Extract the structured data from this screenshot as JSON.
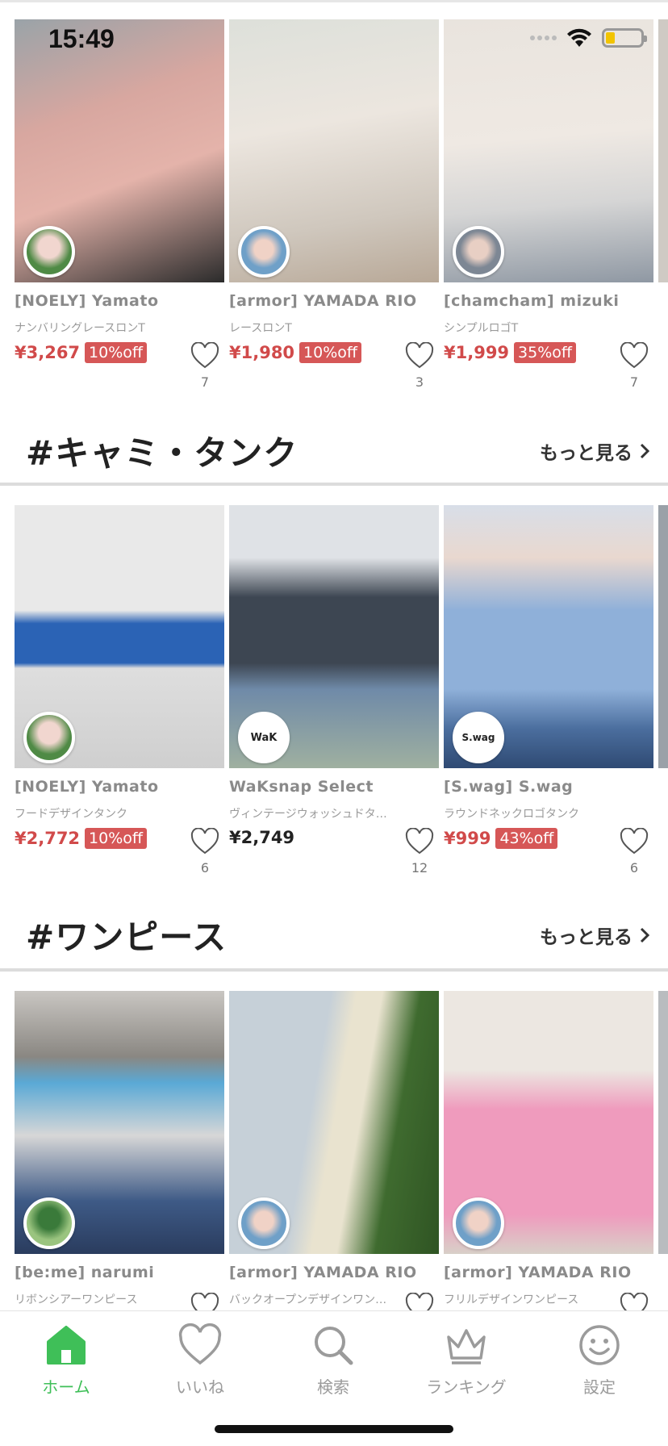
{
  "status_bar": {
    "time": "15:49"
  },
  "sections": [
    {
      "title": "",
      "more_label": "",
      "products": [
        {
          "brand": "[NOELY] Yamato",
          "desc": "ナンバリングレースロンT",
          "price": "¥3,267",
          "discount": "10%off",
          "likes": "7",
          "photo_color": "#d8a7a0",
          "photo_color2": "#8a6b66"
        },
        {
          "brand": "[armor] YAMADA RIO",
          "desc": "レースロンT",
          "price": "¥1,980",
          "discount": "10%off",
          "likes": "3",
          "photo_color": "#ece6df",
          "photo_color2": "#b8a897"
        },
        {
          "brand": "[chamcham] mizuki",
          "desc": "シンプルロゴT",
          "price": "¥1,999",
          "discount": "35%off",
          "likes": "7",
          "photo_color": "#efe9e3",
          "photo_color2": "#8f98a3"
        }
      ]
    },
    {
      "title": "#キャミ・タンク",
      "more_label": "もっと見る",
      "products": [
        {
          "brand": "[NOELY] Yamato",
          "desc": "フードデザインタンク",
          "price": "¥2,772",
          "discount": "10%off",
          "likes": "6",
          "photo_color": "#e9e9e9",
          "photo_color2": "#2b63b5"
        },
        {
          "brand": "WaKsnap Select",
          "desc": "ヴィンテージウォッシュドタンクトップ",
          "price": "¥2,749",
          "discount": "",
          "likes": "12",
          "photo_color": "#dfe2e6",
          "photo_color2": "#4d6c8f",
          "avatar_text": "WaK"
        },
        {
          "brand": "[S.wag] S.wag",
          "desc": "ラウンドネックロゴタンク",
          "price": "¥999",
          "discount": "43%off",
          "likes": "6",
          "photo_color": "#d8dee8",
          "photo_color2": "#8fb0d9",
          "avatar_text": "S.wag"
        }
      ]
    },
    {
      "title": "#ワンピース",
      "more_label": "もっと見る",
      "products": [
        {
          "brand": "[be:me] narumi",
          "desc": "リボンシアーワンピース",
          "price": "",
          "discount": "",
          "likes": "",
          "photo_color": "#c9c6c2",
          "photo_color2": "#5aa9d6"
        },
        {
          "brand": "[armor] YAMADA RIO",
          "desc": "バックオープンデザインワンピース",
          "price": "",
          "discount": "",
          "likes": "",
          "photo_color": "#c6d0d8",
          "photo_color2": "#e9e3cf"
        },
        {
          "brand": "[armor] YAMADA RIO",
          "desc": "フリルデザインワンピース",
          "price": "",
          "discount": "",
          "likes": "",
          "photo_color": "#ece7e1",
          "photo_color2": "#ef9bbd"
        }
      ]
    }
  ],
  "nav": {
    "items": [
      {
        "label": "ホーム",
        "icon": "home-icon",
        "active": true
      },
      {
        "label": "いいね",
        "icon": "heart-icon",
        "active": false
      },
      {
        "label": "検索",
        "icon": "search-icon",
        "active": false
      },
      {
        "label": "ランキング",
        "icon": "crown-icon",
        "active": false
      },
      {
        "label": "設定",
        "icon": "smiley-icon",
        "active": false
      }
    ]
  },
  "colors": {
    "accent": "#3fbf58",
    "price_red": "#d14a4a",
    "badge_red": "#d65757"
  }
}
